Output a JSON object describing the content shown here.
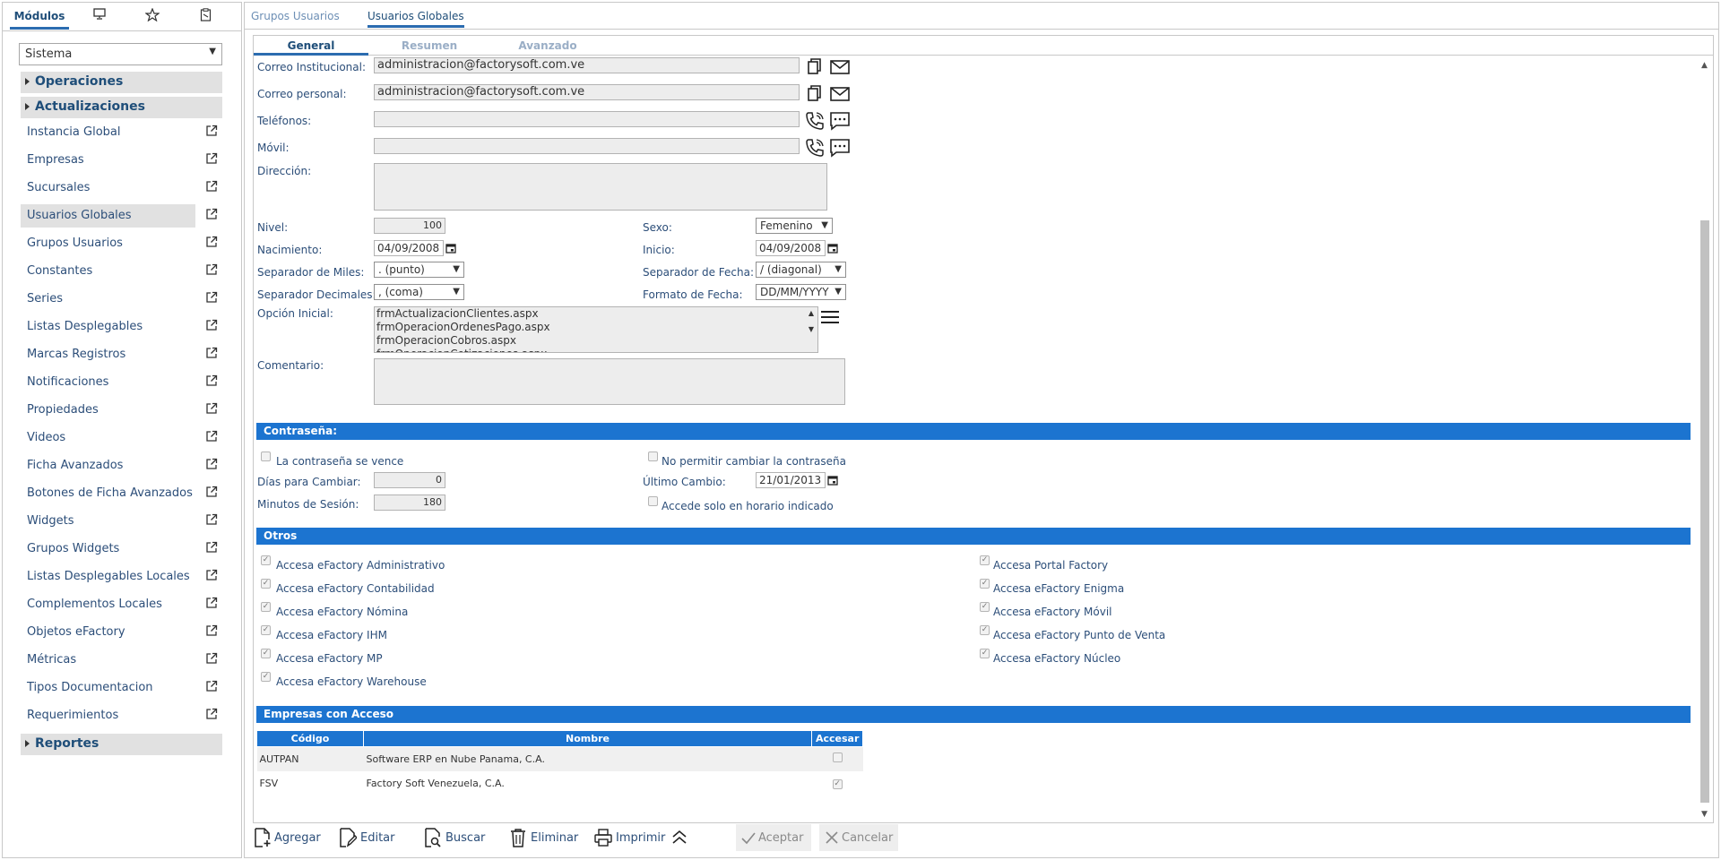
{
  "sidebar": {
    "tabs": {
      "modulos": "Módulos",
      "icons": [
        "monitor-icon",
        "star-icon",
        "clipboard-icon"
      ]
    },
    "module_select": "Sistema",
    "groups": {
      "operaciones": "Operaciones",
      "actualizaciones": "Actualizaciones",
      "reportes": "Reportes"
    },
    "items": [
      {
        "label": "Instancia Global"
      },
      {
        "label": "Empresas"
      },
      {
        "label": "Sucursales"
      },
      {
        "label": "Usuarios Globales"
      },
      {
        "label": "Grupos Usuarios"
      },
      {
        "label": "Constantes"
      },
      {
        "label": "Series"
      },
      {
        "label": "Listas Desplegables"
      },
      {
        "label": "Marcas Registros"
      },
      {
        "label": "Notificaciones"
      },
      {
        "label": "Propiedades"
      },
      {
        "label": "Videos"
      },
      {
        "label": "Ficha Avanzados"
      },
      {
        "label": "Botones de Ficha Avanzados"
      },
      {
        "label": "Widgets"
      },
      {
        "label": "Grupos Widgets"
      },
      {
        "label": "Listas Desplegables Locales"
      },
      {
        "label": "Complementos Locales"
      },
      {
        "label": "Objetos eFactory"
      },
      {
        "label": "Métricas"
      },
      {
        "label": "Tipos Documentacion"
      },
      {
        "label": "Requerimientos"
      }
    ],
    "active_item": "Usuarios Globales"
  },
  "main": {
    "top_tabs": {
      "grupos": "Grupos Usuarios",
      "usuarios": "Usuarios Globales"
    },
    "sub_tabs": {
      "general": "General",
      "resumen": "Resumen",
      "avanzado": "Avanzado"
    }
  },
  "form": {
    "correo_inst": {
      "label": "Correo Institucional:",
      "value": "administracion@factorysoft.com.ve"
    },
    "correo_pers": {
      "label": "Correo personal:",
      "value": "administracion@factorysoft.com.ve"
    },
    "telefonos": {
      "label": "Teléfonos:",
      "value": ""
    },
    "movil": {
      "label": "Móvil:",
      "value": ""
    },
    "direccion": {
      "label": "Dirección:"
    },
    "nivel": {
      "label": "Nivel:",
      "value": "100"
    },
    "sexo": {
      "label": "Sexo:",
      "value": "Femenino"
    },
    "nacimiento": {
      "label": "Nacimiento:",
      "value": "04/09/2008"
    },
    "inicio": {
      "label": "Inicio:",
      "value": "04/09/2008"
    },
    "sep_miles": {
      "label": "Separador de Miles:",
      "value": ". (punto)"
    },
    "sep_fecha": {
      "label": "Separador de Fecha:",
      "value": "/ (diagonal)"
    },
    "sep_dec": {
      "label": "Separador Decimales:",
      "value": ", (coma)"
    },
    "fmt_fecha": {
      "label": "Formato de Fecha:",
      "value": "DD/MM/YYYY"
    },
    "opcion_inicial": {
      "label": "Opción Inicial:",
      "lines": [
        "frmActualizacionClientes.aspx",
        "frmOperacionOrdenesPago.aspx",
        "frmOperacionCobros.aspx",
        "frmOperacionCotizaciones.aspx"
      ]
    },
    "comentario": {
      "label": "Comentario:"
    }
  },
  "password": {
    "title": "Contraseña:",
    "vence": {
      "label": "La contraseña se vence",
      "checked": false
    },
    "no_cambiar": {
      "label": "No permitir cambiar la contraseña",
      "checked": false
    },
    "dias": {
      "label": "Días para Cambiar:",
      "value": "0"
    },
    "ultimo": {
      "label": "Último Cambio:",
      "value": "21/01/2013"
    },
    "minutos": {
      "label": "Minutos de Sesión:",
      "value": "180"
    },
    "horario": {
      "label": "Accede solo en horario indicado",
      "checked": false
    }
  },
  "otros": {
    "title": "Otros",
    "left": [
      {
        "label": "Accesa eFactory Administrativo",
        "checked": true
      },
      {
        "label": "Accesa eFactory Contabilidad",
        "checked": true
      },
      {
        "label": "Accesa eFactory Nómina",
        "checked": true
      },
      {
        "label": "Accesa eFactory IHM",
        "checked": true
      },
      {
        "label": "Accesa eFactory MP",
        "checked": true
      },
      {
        "label": "Accesa eFactory Warehouse",
        "checked": true
      }
    ],
    "right": [
      {
        "label": "Accesa Portal Factory",
        "checked": true
      },
      {
        "label": "Accesa eFactory Enigma",
        "checked": true
      },
      {
        "label": "Accesa eFactory Móvil",
        "checked": true
      },
      {
        "label": "Accesa eFactory Punto de Venta",
        "checked": true
      },
      {
        "label": "Accesa eFactory Núcleo",
        "checked": true
      }
    ]
  },
  "empresas": {
    "title": "Empresas con Acceso",
    "headers": {
      "codigo": "Código",
      "nombre": "Nombre",
      "accesar": "Accesar"
    },
    "rows": [
      {
        "codigo": "AUTPAN",
        "nombre": "Software ERP en Nube Panama, C.A.",
        "accesar": false
      },
      {
        "codigo": "FSV",
        "nombre": "Factory Soft Venezuela, C.A.",
        "accesar": true
      }
    ]
  },
  "toolbar": {
    "agregar": "Agregar",
    "editar": "Editar",
    "buscar": "Buscar",
    "eliminar": "Eliminar",
    "imprimir": "Imprimir",
    "aceptar": "Aceptar",
    "cancelar": "Cancelar"
  },
  "colors": {
    "accent": "#1c74d0",
    "link": "#2c4e79",
    "tab_active": "#2b6cb0"
  }
}
